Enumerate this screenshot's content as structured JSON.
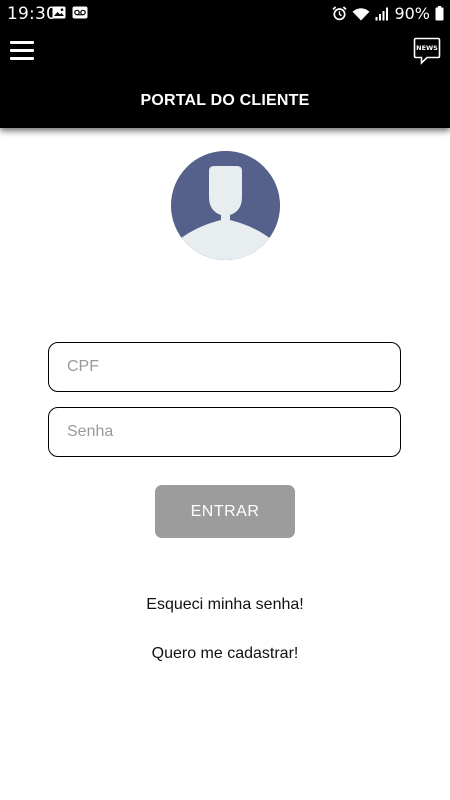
{
  "status_bar": {
    "time": "19:30",
    "battery": "90%",
    "icons": [
      "image-icon",
      "voicemail-icon",
      "alarm-icon",
      "wifi-icon",
      "signal-icon",
      "battery-icon"
    ]
  },
  "app_bar": {
    "title": "PORTAL DO CLIENTE",
    "menu_icon": "hamburger-menu-icon",
    "news_icon": "news-icon",
    "news_icon_text": "NEWS"
  },
  "avatar": {
    "icon": "user-avatar-icon",
    "colors": {
      "background": "#55618a",
      "silhouette": "#e8edf0"
    }
  },
  "form": {
    "cpf_placeholder": "CPF",
    "password_placeholder": "Senha",
    "submit_label": "ENTRAR"
  },
  "links": {
    "forgot_password": "Esqueci minha senha!",
    "register": "Quero me cadastrar!"
  },
  "colors": {
    "app_bar": "#000000",
    "button": "#9c9c9c",
    "background": "#ffffff"
  }
}
